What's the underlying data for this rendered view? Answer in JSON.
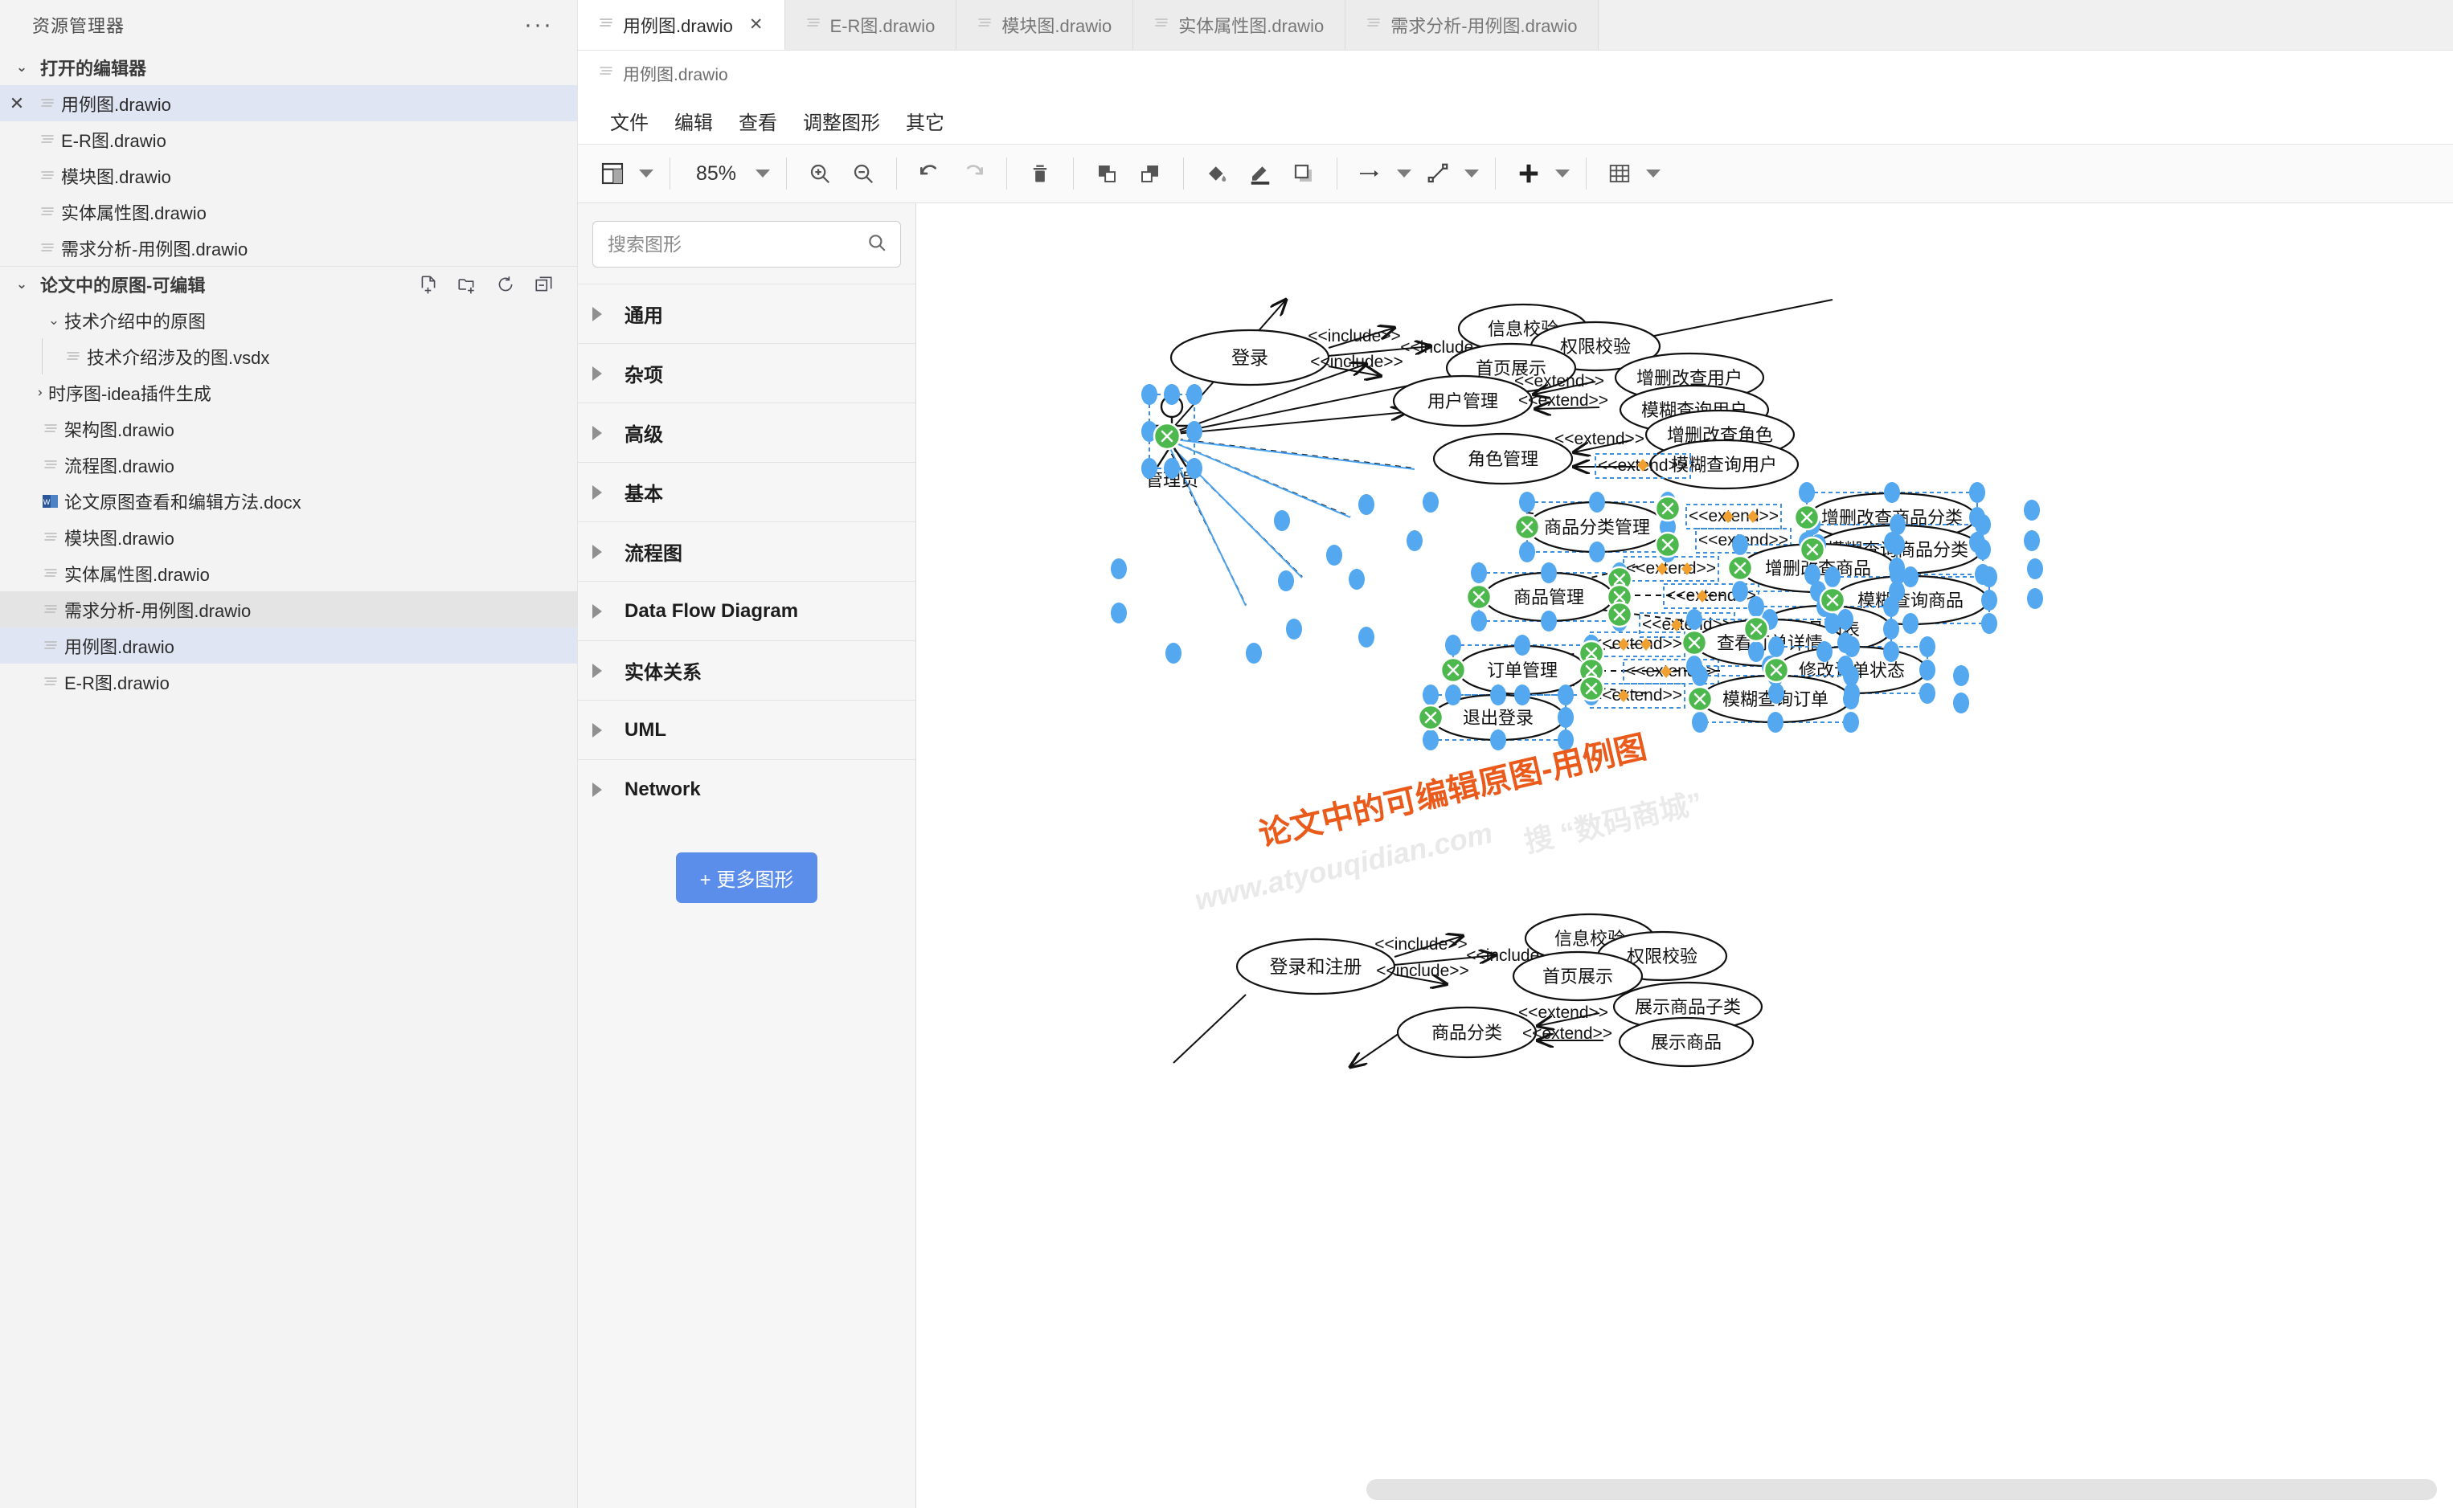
{
  "explorer": {
    "title": "资源管理器",
    "more_label": "···",
    "open_editors": {
      "label": "打开的编辑器",
      "items": [
        {
          "name": "用例图.drawio",
          "selected": true,
          "closable": true
        },
        {
          "name": "E-R图.drawio",
          "selected": false,
          "closable": false
        },
        {
          "name": "模块图.drawio",
          "selected": false,
          "closable": false
        },
        {
          "name": "实体属性图.drawio",
          "selected": false,
          "closable": false
        },
        {
          "name": "需求分析-用例图.drawio",
          "selected": false,
          "closable": false
        }
      ]
    },
    "folder": {
      "label": "论文中的原图-可编辑",
      "actions": [
        "new-file-icon",
        "new-folder-icon",
        "refresh-icon",
        "collapse-all-icon"
      ],
      "items": [
        {
          "name": "技术介绍中的原图",
          "type": "folder",
          "expanded": true,
          "depth": 1
        },
        {
          "name": "技术介绍涉及的图.vsdx",
          "type": "file",
          "depth": 2
        },
        {
          "name": "时序图-idea插件生成",
          "type": "folder",
          "expanded": false,
          "depth": 1
        },
        {
          "name": "架构图.drawio",
          "type": "file",
          "depth": 1
        },
        {
          "name": "流程图.drawio",
          "type": "file",
          "depth": 1
        },
        {
          "name": "论文原图查看和编辑方法.docx",
          "type": "word",
          "depth": 1
        },
        {
          "name": "模块图.drawio",
          "type": "file",
          "depth": 1
        },
        {
          "name": "实体属性图.drawio",
          "type": "file",
          "depth": 1
        },
        {
          "name": "需求分析-用例图.drawio",
          "type": "file",
          "depth": 1,
          "highlight": "grey"
        },
        {
          "name": "用例图.drawio",
          "type": "file",
          "depth": 1,
          "highlight": "blue"
        },
        {
          "name": "E-R图.drawio",
          "type": "file",
          "depth": 1
        }
      ]
    }
  },
  "tabs": [
    {
      "label": "用例图.drawio",
      "active": true,
      "close": "✕"
    },
    {
      "label": "E-R图.drawio",
      "active": false
    },
    {
      "label": "模块图.drawio",
      "active": false
    },
    {
      "label": "实体属性图.drawio",
      "active": false
    },
    {
      "label": "需求分析-用例图.drawio",
      "active": false
    }
  ],
  "breadcrumb": "用例图.drawio",
  "menu": [
    "文件",
    "编辑",
    "查看",
    "调整图形",
    "其它"
  ],
  "toolbar": {
    "zoom_value": "85%",
    "icons": [
      "layout-panel-icon",
      "zoom-in-icon",
      "zoom-out-icon",
      "undo-icon",
      "redo-icon",
      "delete-icon",
      "to-front-icon",
      "to-back-icon",
      "fill-color-icon",
      "line-color-icon",
      "shadow-icon",
      "arrow-style-icon",
      "connection-style-icon",
      "insert-icon",
      "table-icon"
    ]
  },
  "shapes_panel": {
    "search_placeholder": "搜索图形",
    "search_value": "",
    "categories": [
      "通用",
      "杂项",
      "高级",
      "基本",
      "流程图",
      "Data Flow Diagram",
      "实体关系",
      "UML",
      "Network"
    ],
    "more_button": "+ 更多图形"
  },
  "colors": {
    "accent_blue": "#5b8dea",
    "selection_handle": "#59aaf0",
    "endpoint_green": "#46b446",
    "waypoint_orange": "#f0a030",
    "watermark_orange": "#ea5a1b",
    "watermark_grey": "#e8e8e8"
  },
  "chart_data": {
    "type": "diagram",
    "diagram_kind": "uml-use-case",
    "title": "用例图.drawio",
    "watermarks": [
      {
        "text": "论文中的可编辑原图-用例图",
        "color": "#ea5a1b"
      },
      {
        "text": "www.atyouqidian.com  搜 “数码商城”",
        "color": "#e6e6e6"
      }
    ],
    "diagrams": [
      {
        "id": "main",
        "actors": [
          {
            "label": "管理员",
            "selected": true
          }
        ],
        "use_cases": [
          {
            "label": "登录",
            "selected": false
          },
          {
            "label": "信息校验",
            "selected": false
          },
          {
            "label": "权限校验",
            "selected": false
          },
          {
            "label": "首页展示",
            "selected": false
          },
          {
            "label": "用户管理",
            "selected": false
          },
          {
            "label": "增删改查用户",
            "selected": false
          },
          {
            "label": "模糊查询用户",
            "selected": false
          },
          {
            "label": "角色管理",
            "selected": false
          },
          {
            "label": "增删改查角色",
            "selected": false
          },
          {
            "label": "模糊查询用户",
            "selected": false
          },
          {
            "label": "商品分类管理",
            "selected": true
          },
          {
            "label": "增删改查商品分类",
            "selected": true
          },
          {
            "label": "模糊查询商品分类",
            "selected": true
          },
          {
            "label": "商品管理",
            "selected": true
          },
          {
            "label": "增删改查商品",
            "selected": true
          },
          {
            "label": "模糊查询商品",
            "selected": true
          },
          {
            "label": "商品列表",
            "selected": true
          },
          {
            "label": "订单管理",
            "selected": true
          },
          {
            "label": "查看订单详情",
            "selected": true
          },
          {
            "label": "修改订单状态",
            "selected": true
          },
          {
            "label": "模糊查询订单",
            "selected": true
          },
          {
            "label": "退出登录",
            "selected": true
          }
        ],
        "relations": [
          {
            "from": "登录",
            "to": "信息校验",
            "stereotype": "<<include>>"
          },
          {
            "from": "登录",
            "to": "权限校验",
            "stereotype": "<<include>>"
          },
          {
            "from": "登录",
            "to": "首页展示",
            "stereotype": "<<include>>"
          },
          {
            "from": "增删改查用户",
            "to": "用户管理",
            "stereotype": "<<extend>>"
          },
          {
            "from": "模糊查询用户",
            "to": "用户管理",
            "stereotype": "<<extend>>"
          },
          {
            "from": "增删改查角色",
            "to": "角色管理",
            "stereotype": "<<extend>>"
          },
          {
            "from": "模糊查询用户",
            "to": "角色管理",
            "stereotype": "<<extend>>"
          },
          {
            "from": "增删改查商品分类",
            "to": "商品分类管理",
            "stereotype": "<<extend>>"
          },
          {
            "from": "模糊查询商品分类",
            "to": "商品分类管理",
            "stereotype": "<<extend>>"
          },
          {
            "from": "增删改查商品",
            "to": "商品管理",
            "stereotype": "<<extend>>"
          },
          {
            "from": "模糊查询商品",
            "to": "商品管理",
            "stereotype": "<<extend>>"
          },
          {
            "from": "商品列表",
            "to": "商品管理",
            "stereotype": "<<extend>>"
          },
          {
            "from": "查看订单详情",
            "to": "订单管理",
            "stereotype": "<<extend>>"
          },
          {
            "from": "修改订单状态",
            "to": "订单管理",
            "stereotype": "<<extend>>"
          },
          {
            "from": "模糊查询订单",
            "to": "订单管理",
            "stereotype": "<<extend>>"
          }
        ]
      },
      {
        "id": "secondary",
        "use_cases": [
          {
            "label": "登录和注册"
          },
          {
            "label": "信息校验"
          },
          {
            "label": "权限校验"
          },
          {
            "label": "首页展示"
          },
          {
            "label": "商品分类"
          },
          {
            "label": "展示商品子类"
          },
          {
            "label": "展示商品"
          }
        ],
        "relations": [
          {
            "from": "登录和注册",
            "to": "信息校验",
            "stereotype": "<<include>>"
          },
          {
            "from": "登录和注册",
            "to": "权限校验",
            "stereotype": "<<include>>"
          },
          {
            "from": "登录和注册",
            "to": "首页展示",
            "stereotype": "<<include>>"
          },
          {
            "from": "展示商品子类",
            "to": "商品分类",
            "stereotype": "<<extend>>"
          },
          {
            "from": "展示商品",
            "to": "商品分类",
            "stereotype": "<<extend>>"
          }
        ]
      }
    ]
  }
}
